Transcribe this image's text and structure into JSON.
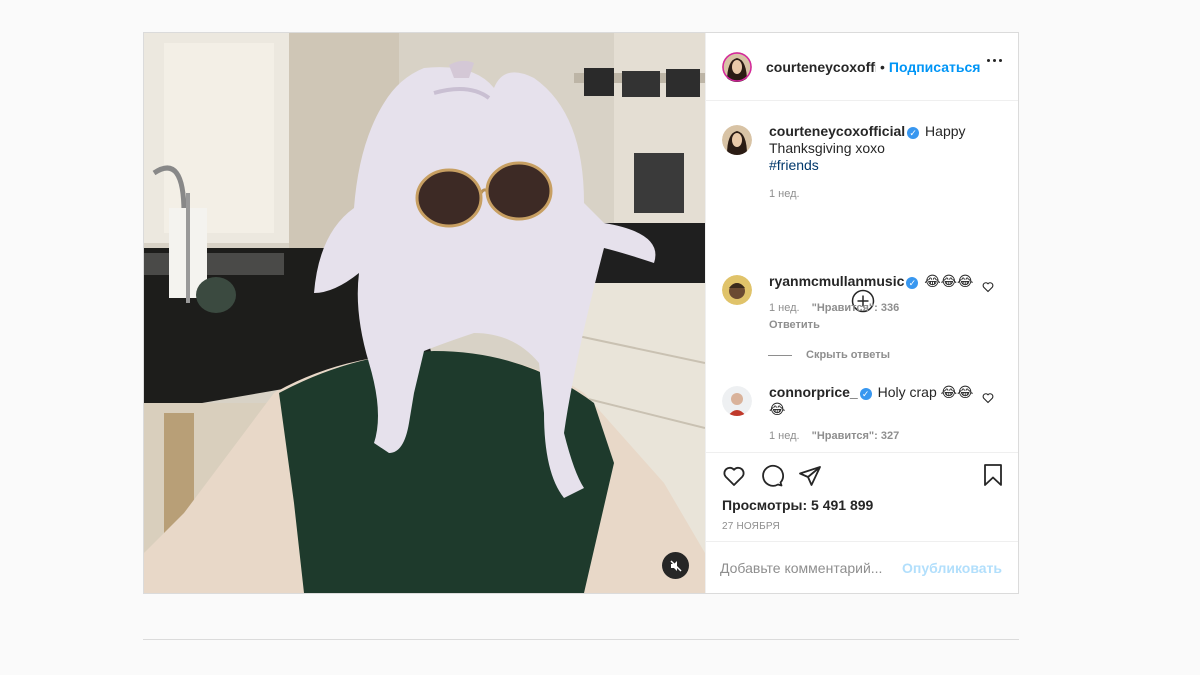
{
  "post": {
    "header": {
      "username": "courteneycoxoffi",
      "dot": "•",
      "follow_label": "Подписаться",
      "more_icon": "more-dots-icon"
    },
    "caption": {
      "username": "courteneycoxofficial",
      "text": "Happy Thanksgiving xoxo",
      "hashtag": "#friends",
      "time": "1 нед."
    },
    "comments": [
      {
        "username": "ryanmcmullanmusic",
        "text": "😂😂😂",
        "time": "1 нед.",
        "likes": "\"Нравится\": 336",
        "reply_label": "Ответить"
      },
      {
        "username": "connorprice_",
        "text": "Holy crap 😂😂😂",
        "time": "1 нед.",
        "likes": "\"Нравится\": 327"
      }
    ],
    "hide_replies_label": "Скрыть ответы",
    "views": "Просмотры: 5 491 899",
    "date": "27 НОЯБРЯ",
    "comment_placeholder": "Добавьте комментарий...",
    "publish_label": "Опубликовать",
    "colors": {
      "accent": "#0095f6",
      "verified": "#3897f0",
      "hashtag": "#00376b",
      "muted": "#8e8e8e"
    }
  }
}
